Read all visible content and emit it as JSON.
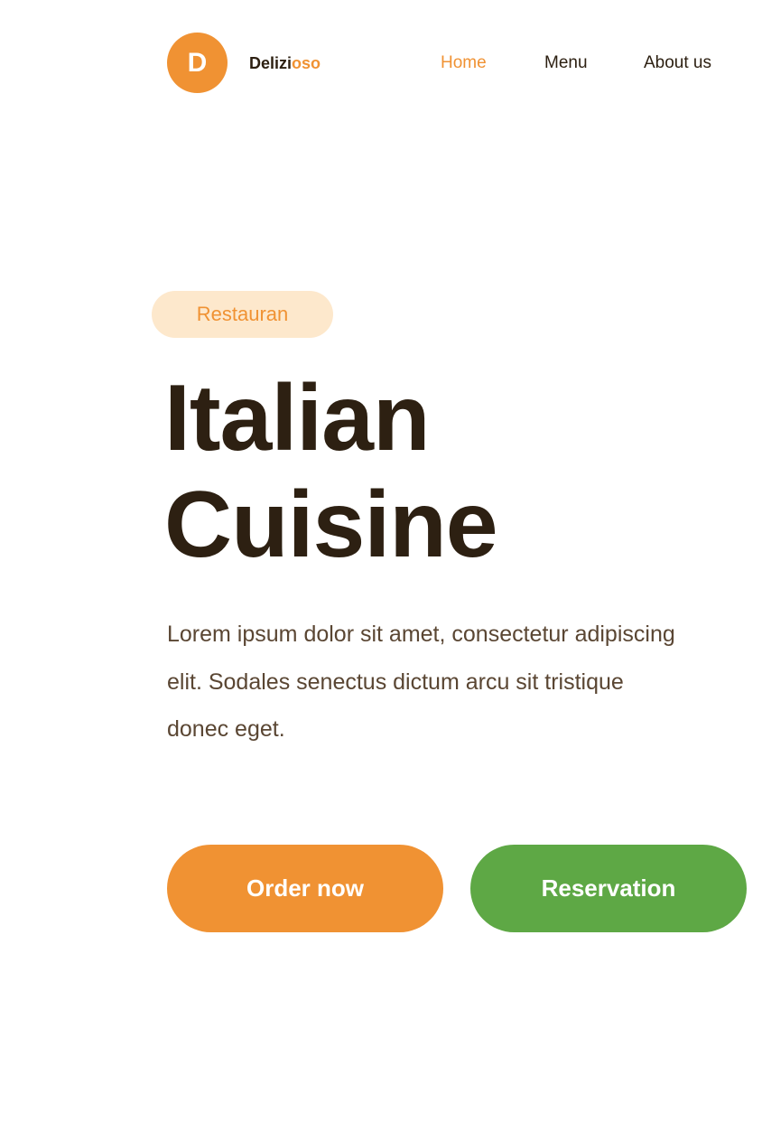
{
  "header": {
    "logo_letter": "D",
    "brand_part1": "Delizi",
    "brand_part2": "oso",
    "nav": [
      {
        "label": "Home",
        "active": true
      },
      {
        "label": "Menu",
        "active": false
      },
      {
        "label": "About us",
        "active": false
      }
    ]
  },
  "hero": {
    "tag": "Restauran",
    "title_line1": "Italian",
    "title_line2": "Cuisine",
    "description_lines": [
      "Lorem ipsum dolor sit amet, consectetur adipiscing",
      "elit. Sodales senectus dictum arcu sit tristique",
      "donec eget."
    ],
    "order_button": "Order now",
    "reservation_button": "Reservation"
  },
  "colors": {
    "accent_orange": "#f09233",
    "accent_green": "#5ea845",
    "tag_background": "#fde8cc",
    "text_dark": "#2d2012"
  }
}
